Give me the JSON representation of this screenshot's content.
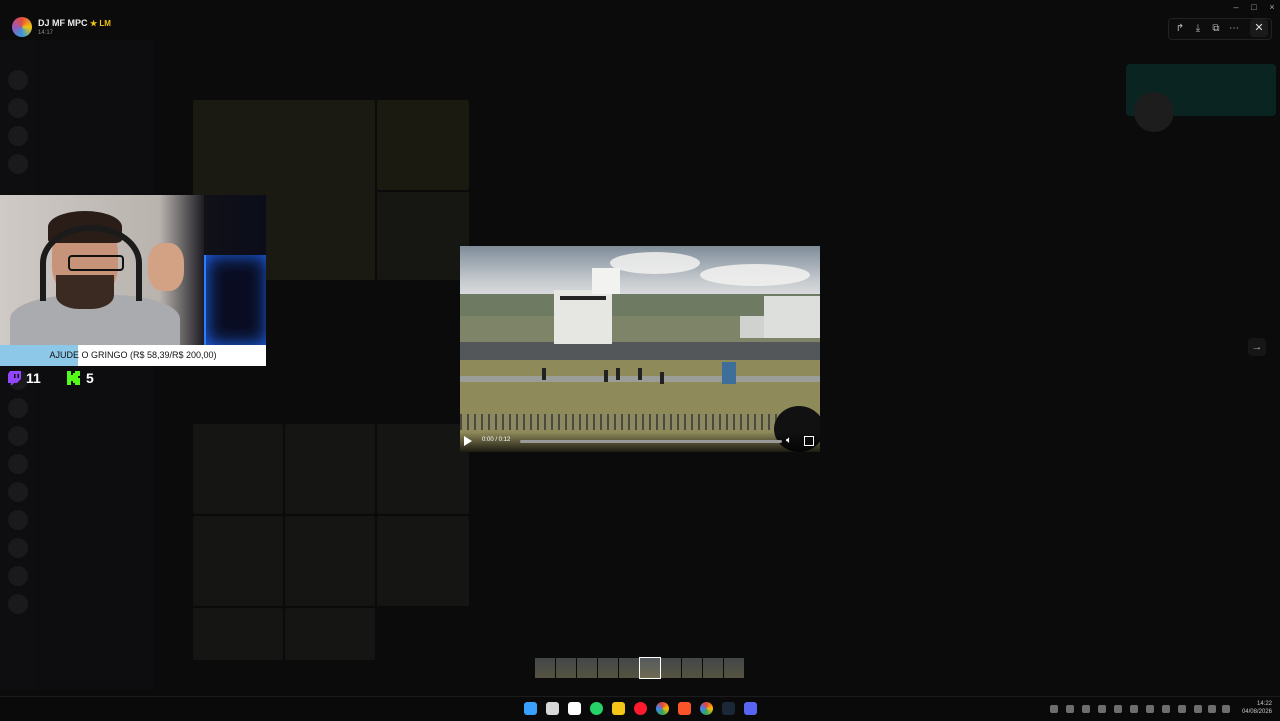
{
  "header": {
    "username": "DJ MF MPC",
    "badge": "LM",
    "timestamp": "14:17"
  },
  "window_controls": {
    "minimize": "–",
    "maximize": "□",
    "close": "×"
  },
  "viewer_actions": {
    "forward_icon": "forward-icon",
    "download_icon": "download-icon",
    "open_icon": "open-external-icon",
    "more_icon": "more-icon",
    "close_label": "✕"
  },
  "stream_overlay": {
    "goal_text": "AJUDE O GRINGO (R$ 58,39/R$ 200,00)",
    "goal_progress": 0.292,
    "twitch_viewers": "11",
    "kick_viewers": "5",
    "colors": {
      "twitch": "#9146ff",
      "kick": "#53fc18",
      "goal_fill": "#8dc8e8"
    }
  },
  "video_player": {
    "time": "0:00 / 0:12",
    "progress": 0.0,
    "play_icon": "play-icon",
    "volume_icon": "volume-icon",
    "fullscreen_icon": "fullscreen-icon"
  },
  "navigation": {
    "next_label": "→"
  },
  "thumbnails": {
    "count": 10,
    "active_index": 5
  },
  "taskbar": {
    "time": "14:22",
    "date": "04/08/2026",
    "apps": [
      "windows-start",
      "notes",
      "capcut",
      "whatsapp",
      "file-explorer",
      "opera",
      "chrome",
      "brave",
      "chrome-alt",
      "steam",
      "discord"
    ]
  }
}
